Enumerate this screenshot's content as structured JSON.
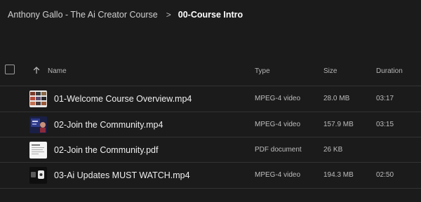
{
  "breadcrumb": {
    "parent": "Anthony Gallo - The Ai Creator Course",
    "separator": ">",
    "current": "00-Course Intro"
  },
  "table": {
    "columns": {
      "name": "Name",
      "type": "Type",
      "size": "Size",
      "duration": "Duration"
    },
    "rows": [
      {
        "name": "01-Welcome Course Overview.mp4",
        "type": "MPEG-4 video",
        "size": "28.0 MB",
        "duration": "03:17",
        "thumb": "video-thumbnail-grid"
      },
      {
        "name": "02-Join the Community.mp4",
        "type": "MPEG-4 video",
        "size": "157.9 MB",
        "duration": "03:15",
        "thumb": "video-thumbnail-screen"
      },
      {
        "name": "02-Join the Community.pdf",
        "type": "PDF document",
        "size": "26 KB",
        "duration": "",
        "thumb": "pdf-thumbnail"
      },
      {
        "name": "03-Ai Updates MUST WATCH.mp4",
        "type": "MPEG-4 video",
        "size": "194.3 MB",
        "duration": "02:50",
        "thumb": "video-thumbnail-dark"
      }
    ]
  },
  "colors": {
    "background": "#1b1b1b",
    "divider": "#333333",
    "text_primary": "#f0f0f0",
    "text_secondary": "#bdbdbd"
  }
}
